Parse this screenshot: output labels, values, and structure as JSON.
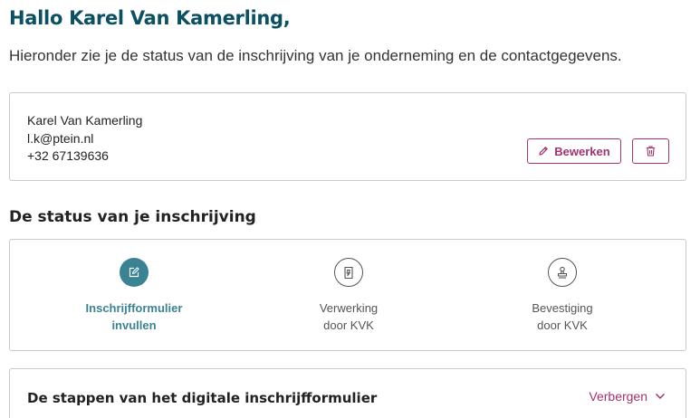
{
  "header": {
    "greeting": "Hallo Karel Van Kamerling,",
    "intro": "Hieronder zie je de status van de inschrijving van je onderneming en de contactgegevens."
  },
  "contact": {
    "name": "Karel Van Kamerling",
    "email": "l.k@ptein.nl",
    "phone": "+32 67139636",
    "edit_label": "Bewerken",
    "edit_icon": "pencil-icon",
    "delete_icon": "trash-icon"
  },
  "status": {
    "title": "De status van je inschrijving",
    "steps": [
      {
        "line1": "Inschrijfformulier",
        "line2": "invullen",
        "icon": "edit-icon",
        "state": "active"
      },
      {
        "line1": "Verwerking",
        "line2": "door KVK",
        "icon": "document-icon",
        "state": "inactive"
      },
      {
        "line1": "Bevestiging",
        "line2": "door KVK",
        "icon": "stamp-icon",
        "state": "inactive"
      }
    ]
  },
  "form_steps": {
    "title": "De stappen van het digitale inschrijfformulier",
    "toggle_label": "Verbergen",
    "toggle_icon": "chevron-down-icon"
  },
  "colors": {
    "heading": "#0b5063",
    "accent": "#a3326f",
    "active_step": "#3a8393"
  }
}
